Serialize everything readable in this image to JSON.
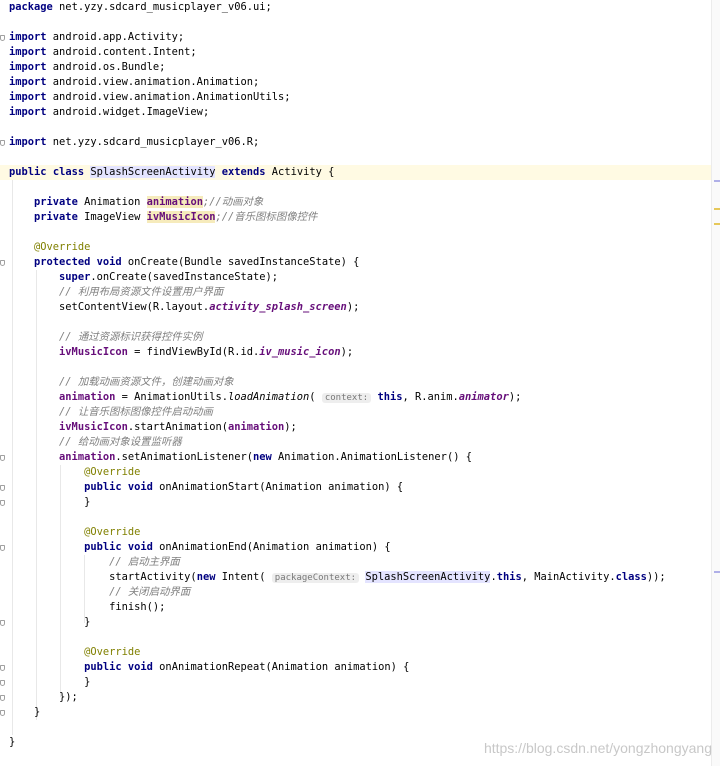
{
  "editor": {
    "line_package": "package",
    "line_package_rest": " net.yzy.sdcard_musicplayer_v06.ui;",
    "imports": [
      " android.app.Activity;",
      " android.content.Intent;",
      " android.os.Bundle;",
      " android.view.animation.Animation;",
      " android.view.animation.AnimationUtils;",
      " android.widget.ImageView;"
    ],
    "import_r": " net.yzy.sdcard_musicplayer_v06.R;",
    "kw_import": "import",
    "kw_public": "public",
    "kw_class": "class",
    "kw_extends": "extends",
    "kw_private": "private",
    "kw_protected": "protected",
    "kw_void": "void",
    "kw_super": "super",
    "kw_this": "this",
    "kw_new": "new",
    "class_name": "SplashScreenActivity",
    "extends_rest": " Activity {",
    "field1_type": " Animation ",
    "field1_name": "animation",
    "field1_comment": ";//动画对象",
    "field2_type": " ImageView ",
    "field2_name": "ivMusicIcon",
    "field2_comment": ";//音乐图标图像控件",
    "override": "@Override",
    "oncreate_sig": " onCreate(Bundle savedInstanceState) {",
    "super_call": ".onCreate(savedInstanceState);",
    "cmt_layout": "// 利用布局资源文件设置用户界面",
    "setcontent_a": "setContentView(R.layout.",
    "setcontent_f": "activity_splash_screen",
    "setcontent_b": ");",
    "cmt_find": "// 通过资源标识获得控件实例",
    "find_a": " = findViewById(R.id.",
    "find_f": "iv_music_icon",
    "find_b": ");",
    "cmt_load": "// 加载动画资源文件，创建动画对象",
    "load_a": " = AnimationUtils.",
    "load_m": "loadAnimation",
    "load_b": "( ",
    "hint_context": "context:",
    "load_c": ", R.anim.",
    "load_f": "animator",
    "load_d": ");",
    "cmt_start": "// 让音乐图标图像控件启动动画",
    "start_a": ".startAnimation(",
    "start_b": ");",
    "cmt_listener": "// 给动画对象设置监听器",
    "listener_a": ".setAnimationListener(",
    "listener_b": " Animation.AnimationListener() {",
    "on_start_sig": " onAnimationStart(Animation animation) {",
    "close_brace": "}",
    "on_end_sig": " onAnimationEnd(Animation animation) {",
    "cmt_main": "// 启动主界面",
    "startact_a": "startActivity(",
    "startact_b": " Intent( ",
    "hint_package": "packageContext:",
    "startact_c": ".",
    "startact_d": ", MainActivity.",
    "startact_e": "));",
    "cmt_close": "// 关闭启动界面",
    "finish": "finish();",
    "on_repeat_sig": " onAnimationRepeat(Animation animation) {",
    "close_listener": "});"
  },
  "watermark": "https://blog.csdn.net/yongzhongyang",
  "colors": {
    "keyword": "#000080",
    "annotation": "#808000",
    "field": "#660e7a",
    "comment": "#808080",
    "current_line": "#fffae3"
  }
}
